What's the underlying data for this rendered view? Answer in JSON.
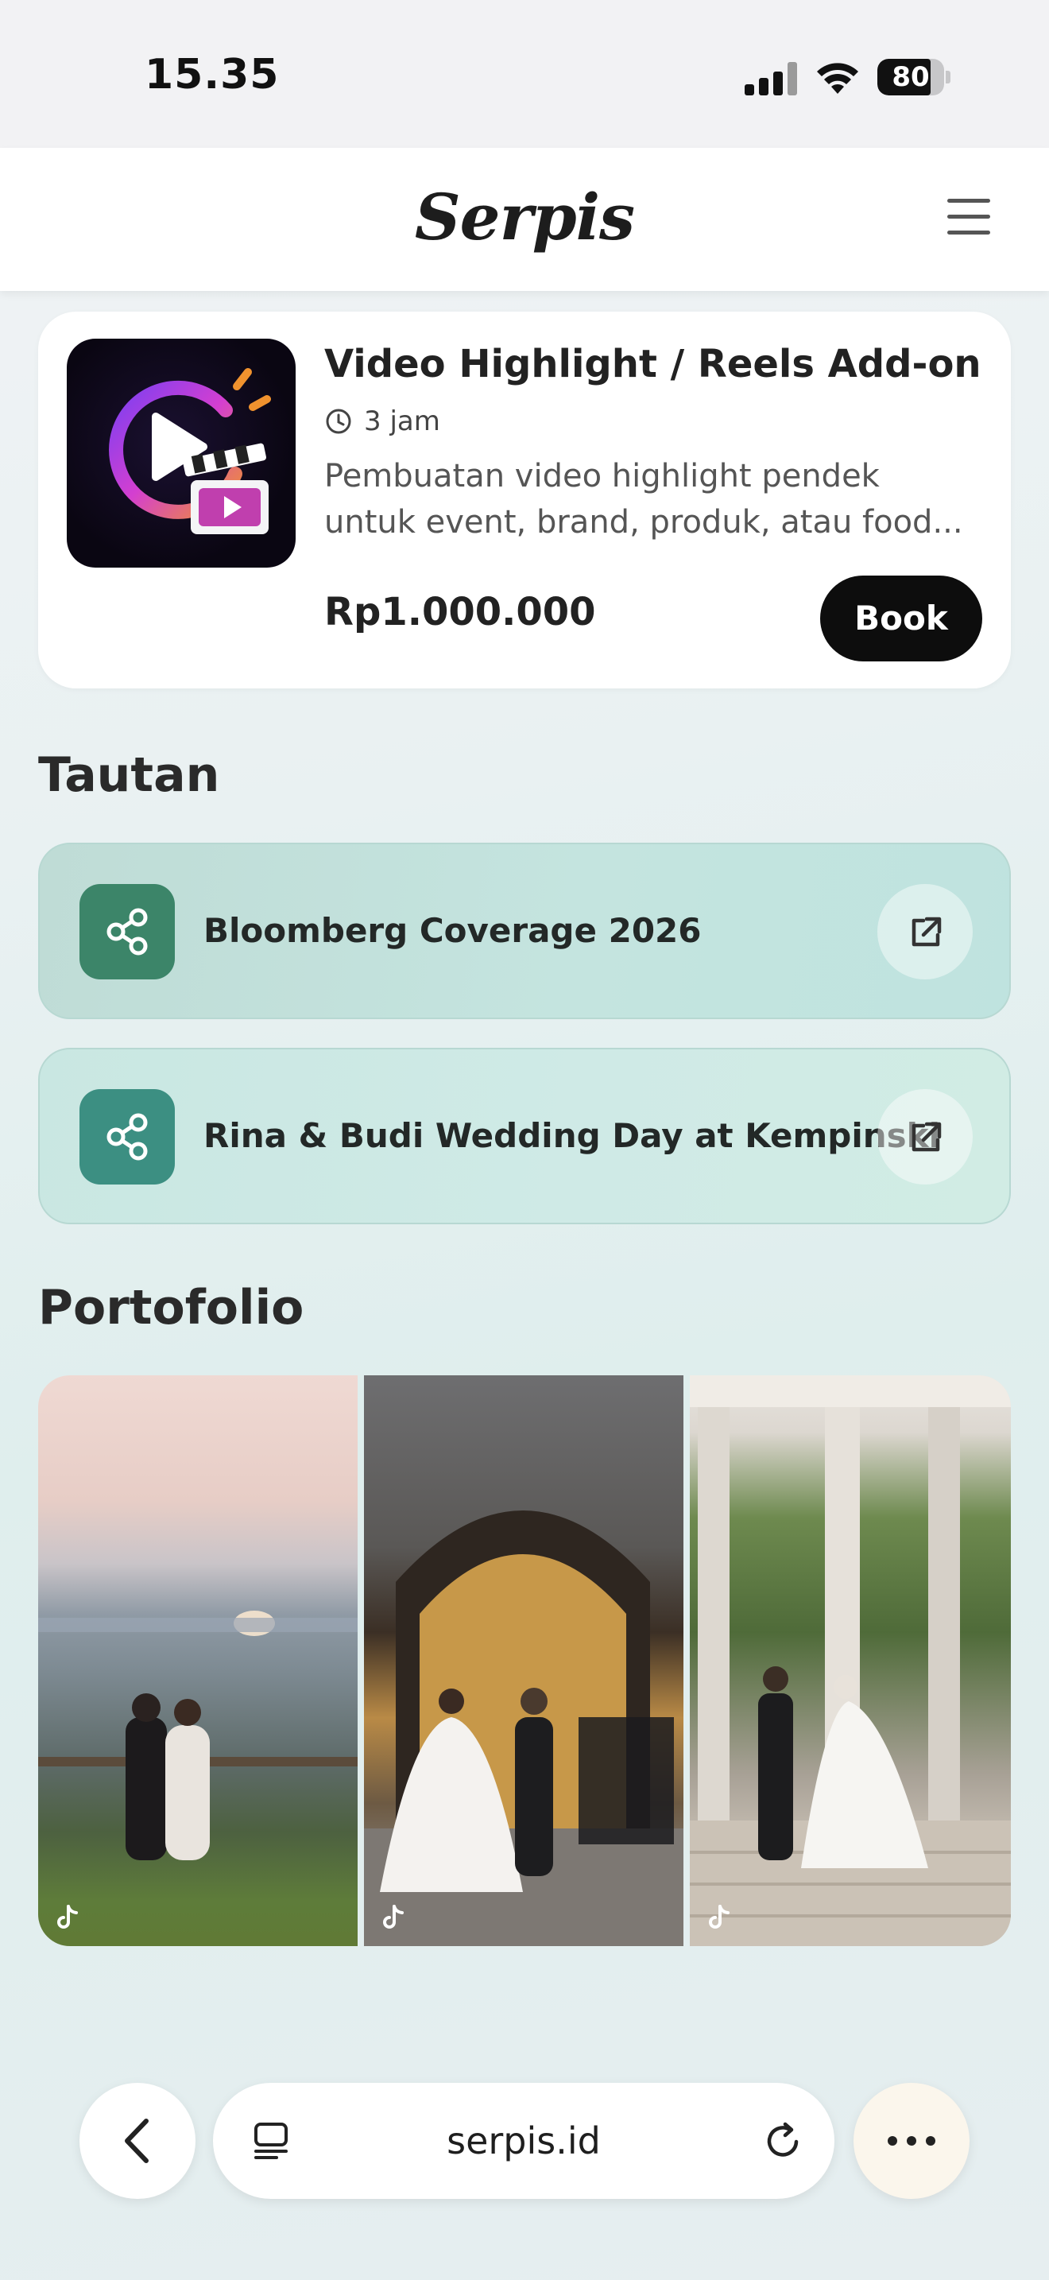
{
  "status_bar": {
    "time": "15.35",
    "battery": "80",
    "battery_level": 0.8
  },
  "header": {
    "logo": "Serpis"
  },
  "service": {
    "title": "Video Highlight / Reels Add-on",
    "duration": "3 jam",
    "description": "Pembuatan video highlight pendek untuk event, brand, produk, atau food...",
    "price": "Rp1.000.000",
    "book_label": "Book"
  },
  "links_section": {
    "title": "Tautan",
    "items": [
      {
        "label": "Bloomberg Coverage 2026"
      },
      {
        "label": "Rina & Budi Wedding Day at Kempinski"
      }
    ]
  },
  "portfolio_section": {
    "title": "Portofolio",
    "items": [
      {
        "kind": "tiktok-video"
      },
      {
        "kind": "tiktok-video"
      },
      {
        "kind": "tiktok-video"
      }
    ]
  },
  "browser": {
    "url": "serpis.id"
  },
  "colors": {
    "accent_dark": "#0d0d0d",
    "share_icon_1": "#3c8569",
    "share_icon_2": "#3c8f82"
  }
}
